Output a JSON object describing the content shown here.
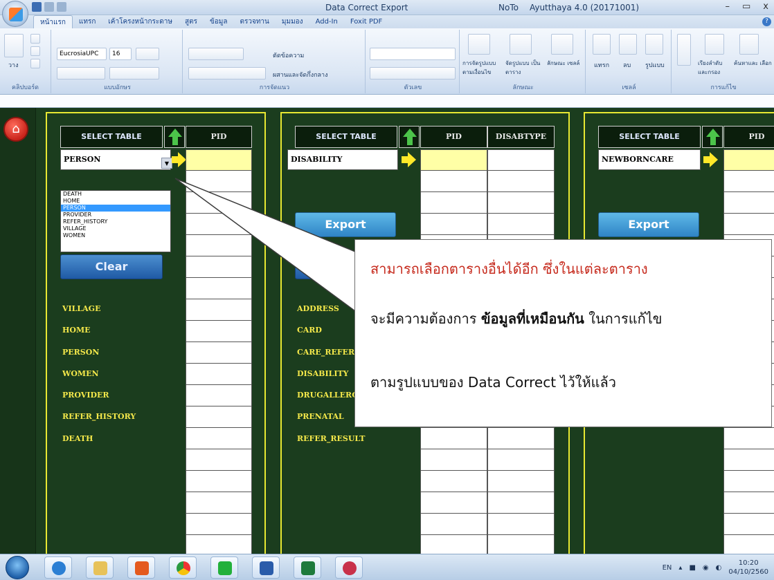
{
  "window": {
    "title": "Data Correct Export",
    "user": "NoTo",
    "version": "Ayutthaya 4.0  (20171001)",
    "controls": [
      "–",
      "▭",
      "x"
    ]
  },
  "ribbon": {
    "tabs": [
      "หน้าแรก",
      "แทรก",
      "เค้าโครงหน้ากระดาษ",
      "สูตร",
      "ข้อมูล",
      "ตรวจทาน",
      "มุมมอง",
      "Add-In",
      "Foxit PDF"
    ],
    "active_tab": "หน้าแรก",
    "font_name": "EucrosiaUPC",
    "font_size": "16",
    "groups": [
      "คลิปบอร์ด",
      "แบบอักษร",
      "การจัดแนว",
      "ตัวเลข",
      "ลักษณะ",
      "เซลล์",
      "การแก้ไข"
    ],
    "paste_label": "วาง",
    "wrap_text": "ตัดข้อความ",
    "merge_center": "ผสานและจัดกึ่งกลาง",
    "style_buttons": [
      "การจัดรูปแบบ ตามเงื่อนไข",
      "จัดรูปแบบ เป็นตาราง",
      "ลักษณะ เซลล์"
    ],
    "cell_buttons": [
      "แทรก",
      "ลบ",
      "รูปแบบ"
    ],
    "edit_buttons": [
      "เรียงลำดับ และกรอง",
      "ค้นหาและ เลือก"
    ]
  },
  "sheet": {
    "panels": [
      {
        "select_header": "SELECT TABLE",
        "selected": "PERSON",
        "columns": [
          "PID"
        ],
        "button": "Clear",
        "tables": [
          "VILLAGE",
          "HOME",
          "PERSON",
          "WOMEN",
          "PROVIDER",
          "REFER_HISTORY",
          "DEATH"
        ]
      },
      {
        "select_header": "SELECT TABLE",
        "selected": "DISABILITY",
        "columns": [
          "PID",
          "DISABTYPE"
        ],
        "button": "Export",
        "tables": [
          "ADDRESS",
          "CARD",
          "CARE_REFER",
          "DISABILITY",
          "DRUGALLERGY",
          "PRENATAL",
          "REFER_RESULT"
        ]
      },
      {
        "select_header": "SELECT TABLE",
        "selected": "NEWBORNCARE",
        "columns": [
          "PID"
        ],
        "button": "Export"
      }
    ],
    "dropdown": {
      "options": [
        "DEATH",
        "HOME",
        "PERSON",
        "PROVIDER",
        "REFER_HISTORY",
        "VILLAGE",
        "WOMEN"
      ],
      "highlighted": "PERSON"
    }
  },
  "callout": {
    "line1": "สามารถเลือกตารางอื่นได้อีก ซึ่งในแต่ละตาราง",
    "line2_pre": "จะมีความต้องการ ",
    "line2_bold": "ข้อมูลที่เหมือนกัน",
    "line2_post": " ในการแก้ไข",
    "line3": "ตามรูปแบบของ Data Correct ไว้ให้แล้ว"
  },
  "taskbar": {
    "lang": "EN",
    "time": "10:20",
    "date": "04/10/2560"
  },
  "colors": {
    "sheet_bg": "#1b3d1e",
    "panel_border": "#e8e832",
    "label": "#f4e84a",
    "input_yellow": "#ffffa6",
    "callout_red": "#c62a1d"
  }
}
